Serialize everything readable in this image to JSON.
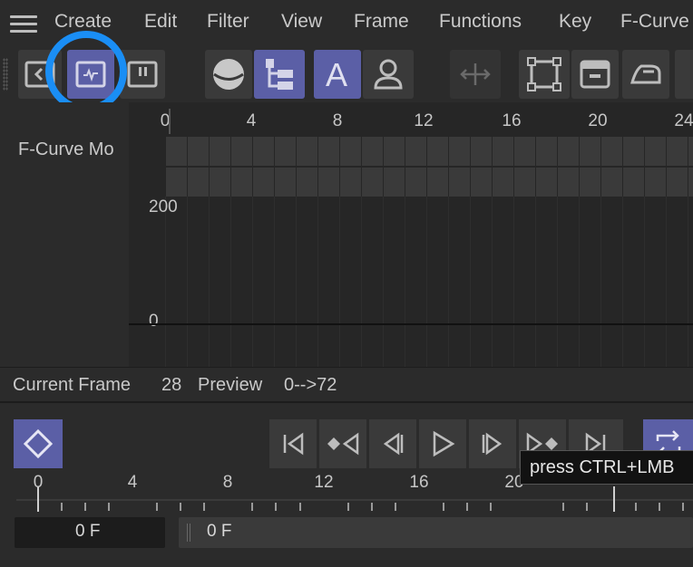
{
  "menu": {
    "items": [
      "Create",
      "Edit",
      "Filter",
      "View",
      "Frame",
      "Functions",
      "Key",
      "F-Curve"
    ]
  },
  "toolbar": {
    "buttons": [
      {
        "name": "dope-sheet-icon",
        "active": false
      },
      {
        "name": "f-curve-mode-icon",
        "active": true
      },
      {
        "name": "motion-mode-icon",
        "active": false
      },
      {
        "name": "sphere-icon",
        "active": false
      },
      {
        "name": "hierarchy-icon",
        "active": true
      },
      {
        "name": "text-a-icon",
        "active": true,
        "label": "A"
      },
      {
        "name": "user-icon",
        "active": false
      },
      {
        "name": "move-arrows-icon",
        "active": false
      },
      {
        "name": "frame-select-icon",
        "active": false
      },
      {
        "name": "clapper-icon",
        "active": false
      },
      {
        "name": "iron-icon",
        "active": false
      }
    ]
  },
  "graph": {
    "panel_label": "F-Curve Mo",
    "ruler": [
      "0",
      "4",
      "8",
      "12",
      "16",
      "20",
      "24"
    ],
    "y_labels": [
      "200",
      "0"
    ]
  },
  "status": {
    "current_frame_label": "Current Frame",
    "current_frame_value": "28",
    "preview_label": "Preview",
    "preview_value": "0-->72"
  },
  "timeline": {
    "ruler": [
      "0",
      "4",
      "8",
      "12",
      "16",
      "20"
    ],
    "tooltip": "press CTRL+LMB",
    "start_field": "0 F",
    "end_field": "0 F"
  },
  "colors": {
    "accent": "#5b5fa6",
    "highlight_ring": "#1a8ef5",
    "background": "#2a2a2a"
  }
}
